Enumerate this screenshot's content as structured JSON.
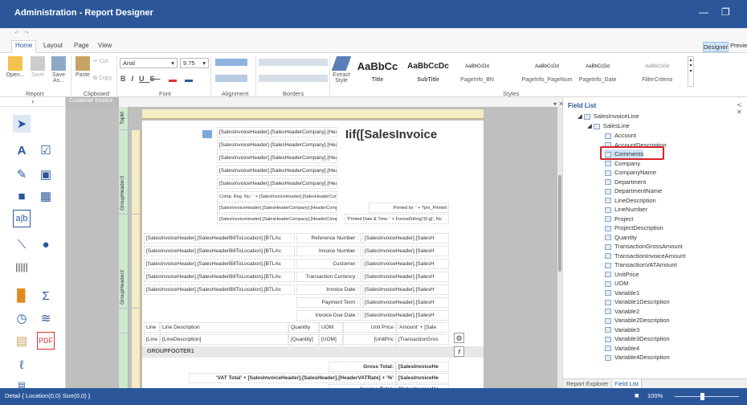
{
  "window": {
    "title": "Administration - Report Designer"
  },
  "ribbon_tabs": [
    "Home",
    "Layout",
    "Page",
    "View"
  ],
  "view_buttons": {
    "designer": "Designer",
    "preview": "Previe"
  },
  "report_group": {
    "open": "Open...",
    "save": "Save",
    "save_as": "Save As...",
    "label": "Report"
  },
  "clipboard_group": {
    "cut": "Cut",
    "paste": "Paste",
    "copy": "Copy",
    "label": "Clipboard"
  },
  "font_group": {
    "font_name": "Arial",
    "font_size": "9.75",
    "label": "Font",
    "bold": "B",
    "italic": "I",
    "underline": "U",
    "strike": "S"
  },
  "alignment_group": {
    "label": "Alignment"
  },
  "borders_group": {
    "label": "Borders"
  },
  "extract": {
    "label": "Extract Style"
  },
  "styles": [
    {
      "sample": "AaBbCc",
      "name": "Title"
    },
    {
      "sample": "AaBbCcDc",
      "name": "SubTitle"
    },
    {
      "sample": "AaBbCcDd",
      "name": "PageInfo_BN"
    },
    {
      "sample": "AaBbCcDd",
      "name": "PageInfo_PageNum"
    },
    {
      "sample": "AaBbCcDd",
      "name": "PageInfo_Date"
    },
    {
      "sample": "AaBbCcDd",
      "name": "FilterCriteria"
    }
  ],
  "styles_label": "Styles",
  "document_tab": "Customer Invoice",
  "bands": [
    "TopM",
    "GroupHeader3",
    "GroupHeader2",
    "GROUPFOOTER1"
  ],
  "report": {
    "big_title": "Iif([SalesInvoice",
    "company_fields": [
      "[SalesInvoiceHeader].[SalesHeaderCompany].[Heade",
      "[SalesInvoiceHeader].[SalesHeaderCompany].[Header",
      "[SalesInvoiceHeader].[SalesHeaderCompany].[Header",
      "[SalesInvoiceHeader].[SalesHeaderCompany].[Header",
      "[SalesInvoiceHeader].[SalesHeaderCompany].[Header"
    ],
    "comp_reg": "Comp. Reg. No.: ' + [SalesInvoiceHeader].[SalesHeaderCompany].[H",
    "company_small_1": "[SalesInvoiceHeader].[SalesHeaderCompany].[HeaderCompa",
    "company_small_2": "[SalesInvoiceHeader].[SalesHeaderCompany].[HeaderCompa",
    "printed_by": "Printed by: ' + ?pm_Printed",
    "printed_date": "'Printed Date & Time: ' + FormatString('{0:g}', No",
    "bill_fields": [
      "[SalesInvoiceHeader].[SalesHeaderBillToLocation].[BTLAc",
      "[SalesInvoiceHeader].[SalesHeaderBillToLocation].[BTLAc",
      "[SalesInvoiceHeader].[SalesHeaderBillToLocation].[BTLAc",
      "[SalesInvoiceHeader].[SalesHeaderBillToLocation].[BTLAc",
      "[SalesInvoiceHeader].[SalesHeaderBillToLocation].[BTLAc"
    ],
    "info_labels": [
      "Reference Number :",
      "Invoice Number :",
      "Customer :",
      "Transaction Currency :",
      "Invoice Date :",
      "Payment Term :",
      "Invoice Due Date :"
    ],
    "info_values": [
      "[SalesInvoiceHeader].[SalesH",
      "[SalesInvoiceHeader].[SalesH",
      "[SalesInvoiceHeader].[SalesH",
      "[SalesInvoiceHeader].[SalesH",
      "[SalesInvoiceHeader].[SalesH",
      "[SalesInvoiceHeader].[SalesH",
      "[SalesInvoiceHeader].[SalesH"
    ],
    "line_headers": [
      "Line",
      "Line Description",
      "Quantity",
      "UOM",
      "Unit Price",
      "'Amount' + [Sale"
    ],
    "line_values": [
      "[Line",
      "[LineDescription]",
      "[Quantity]",
      "[UOM]",
      "[UnitPric",
      "[TransactionGros"
    ],
    "group_footer": "GROUPFOOTER1",
    "gross_total_label": "Gross Total:",
    "gross_total_value": "[SalesInvoiceHe",
    "vat_total": "'VAT Total' + [SalesInvoiceHeader].[SalesHeader].[HeaderVATRate] + '%'",
    "vat_value": "[SalesInvoiceHe",
    "invoice_total_label": "Invoice Total:",
    "invoice_total_value": "[SalesInvoiceHe"
  },
  "field_list": {
    "title": "Field List",
    "root": "SalesInvoiceLine",
    "parent": "SalesLine",
    "items": [
      "Account",
      "AccountDescription",
      "Comments",
      "Company",
      "CompanyName",
      "Department",
      "DepartmentName",
      "LineDescription",
      "LineNumber",
      "Project",
      "ProjectDescription",
      "Quantity",
      "TransactionGrossAmount",
      "TransactionInvoiceAmount",
      "TransactionVATAmount",
      "UnitPrice",
      "UOM",
      "Variable1",
      "Variable1Description",
      "Variable2",
      "Variable2Description",
      "Variable3",
      "Variable3Description",
      "Variable4",
      "Variable4Description"
    ],
    "selected": "Comments",
    "bottom_tabs": [
      "Report Explorer",
      "Field List"
    ]
  },
  "status": {
    "text": "Detail { Location(0,0) Size(0,0) }",
    "zoom": "100%"
  },
  "colors": {
    "accent": "#2b579a",
    "highlight": "#d6242a"
  }
}
